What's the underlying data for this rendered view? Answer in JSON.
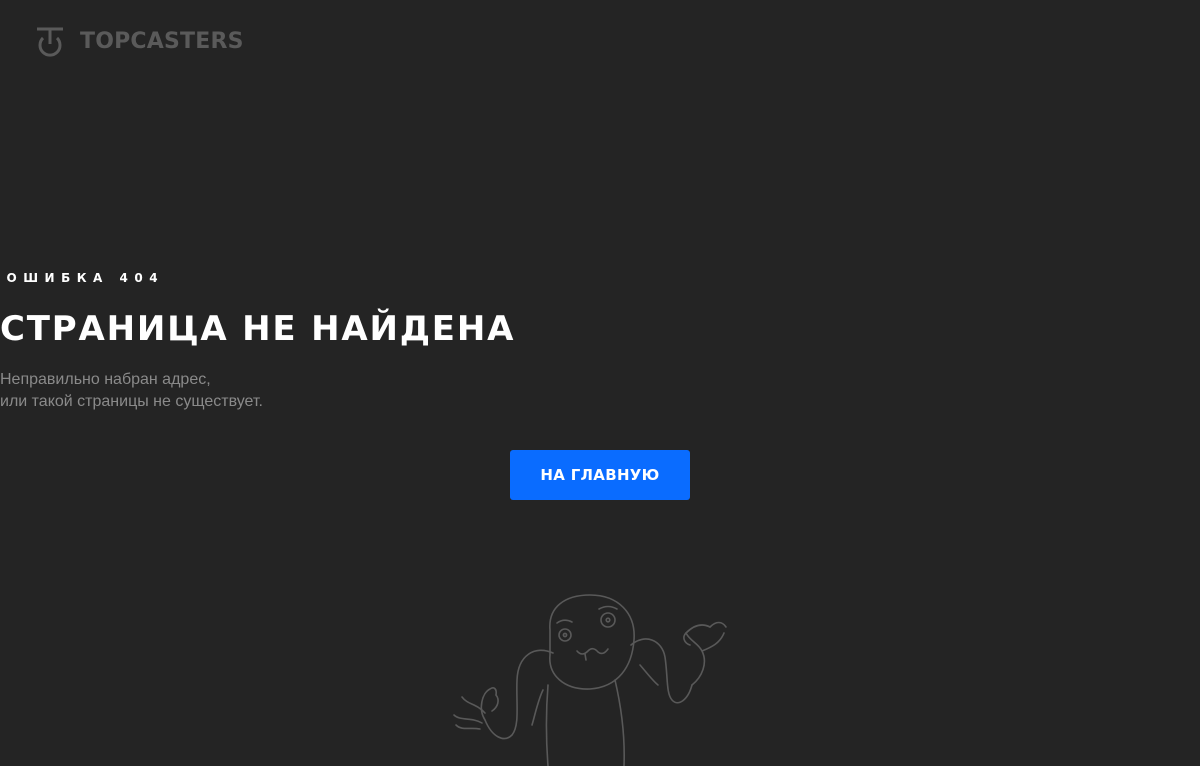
{
  "header": {
    "logo_text": "TOPCASTERS",
    "logo_icon": "topcasters-logo-icon"
  },
  "error": {
    "eyebrow": "ОШИБКА 404",
    "title": "СТРАНИЦА НЕ НАЙДЕНА",
    "description_line1": "Неправильно набран адрес,",
    "description_line2": "или такой страницы не существует.",
    "home_button_label": "НА ГЛАВНУЮ"
  },
  "illustration": {
    "icon": "shrugging-person-illustration"
  },
  "colors": {
    "background": "#242424",
    "accent": "#0a6cff",
    "text_primary": "#ffffff",
    "text_secondary": "#8a8a8a",
    "logo": "#5a5a5a"
  }
}
